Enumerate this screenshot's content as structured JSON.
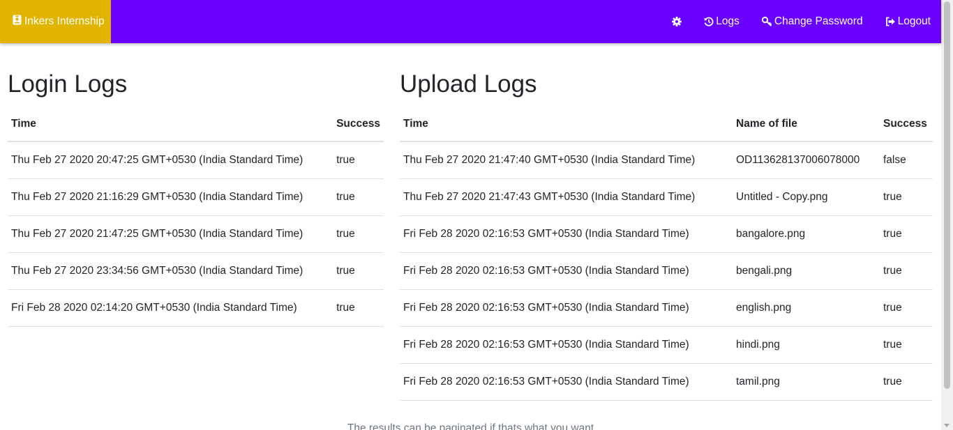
{
  "navbar": {
    "brand": "Inkers Internship",
    "logs": "Logs",
    "change_password": "Change Password",
    "logout": "Logout",
    "colors": {
      "bar": "#6a00ff",
      "brand": "#e1b400"
    },
    "icons": [
      "id-badge-icon",
      "gear-icon",
      "history-icon",
      "key-icon",
      "sign-out-icon"
    ]
  },
  "login_logs": {
    "title": "Login Logs",
    "headers": [
      "Time",
      "Success"
    ],
    "rows": [
      [
        "Thu Feb 27 2020 20:47:25 GMT+0530 (India Standard Time)",
        "true"
      ],
      [
        "Thu Feb 27 2020 21:16:29 GMT+0530 (India Standard Time)",
        "true"
      ],
      [
        "Thu Feb 27 2020 21:47:25 GMT+0530 (India Standard Time)",
        "true"
      ],
      [
        "Thu Feb 27 2020 23:34:56 GMT+0530 (India Standard Time)",
        "true"
      ],
      [
        "Fri Feb 28 2020 02:14:20 GMT+0530 (India Standard Time)",
        "true"
      ]
    ]
  },
  "upload_logs": {
    "title": "Upload Logs",
    "headers": [
      "Time",
      "Name of file",
      "Success"
    ],
    "rows": [
      [
        "Thu Feb 27 2020 21:47:40 GMT+0530 (India Standard Time)",
        "OD113628137006078000",
        "false"
      ],
      [
        "Thu Feb 27 2020 21:47:43 GMT+0530 (India Standard Time)",
        "Untitled - Copy.png",
        "true"
      ],
      [
        "Fri Feb 28 2020 02:16:53 GMT+0530 (India Standard Time)",
        "bangalore.png",
        "true"
      ],
      [
        "Fri Feb 28 2020 02:16:53 GMT+0530 (India Standard Time)",
        "bengali.png",
        "true"
      ],
      [
        "Fri Feb 28 2020 02:16:53 GMT+0530 (India Standard Time)",
        "english.png",
        "true"
      ],
      [
        "Fri Feb 28 2020 02:16:53 GMT+0530 (India Standard Time)",
        "hindi.png",
        "true"
      ],
      [
        "Fri Feb 28 2020 02:16:53 GMT+0530 (India Standard Time)",
        "tamil.png",
        "true"
      ]
    ]
  },
  "footer": {
    "note": "The results can be paginated if thats what you want"
  }
}
